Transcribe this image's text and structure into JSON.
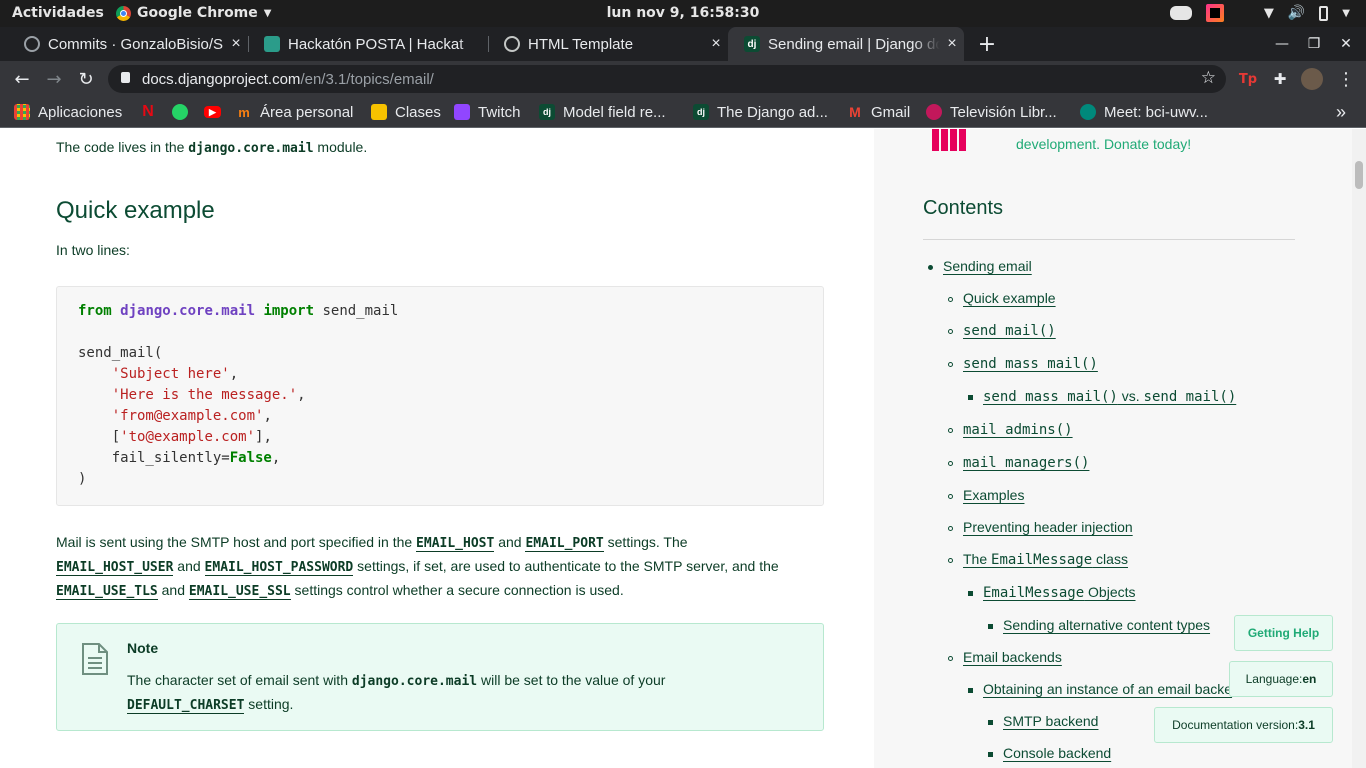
{
  "gnome": {
    "activities": "Actividades",
    "app_name": "Google Chrome",
    "clock": "lun nov  9, 16:58:30"
  },
  "tabs": [
    {
      "title": "Commits · GonzaloBisio/S",
      "close": "×"
    },
    {
      "title": "Hackatón POSTA | Hackat",
      "close": ""
    },
    {
      "title": "HTML Template",
      "close": "×"
    },
    {
      "title": "Sending email | Django do",
      "close": "×"
    }
  ],
  "new_tab": "+",
  "window_controls": {
    "minimize": "—",
    "maximize": "❐",
    "close": "✕"
  },
  "omnibox": {
    "domain": "docs.djangoproject.com",
    "path": "/en/3.1/topics/email/"
  },
  "bookmarks": [
    {
      "label": "Aplicaciones"
    },
    {
      "label": ""
    },
    {
      "label": ""
    },
    {
      "label": ""
    },
    {
      "label": "Área personal"
    },
    {
      "label": "Clases"
    },
    {
      "label": "Twitch"
    },
    {
      "label": "Model field re..."
    },
    {
      "label": "The Django ad..."
    },
    {
      "label": "Gmail"
    },
    {
      "label": "Televisión Libr..."
    },
    {
      "label": "Meet: bci-uwv..."
    }
  ],
  "bookmarks_more": "»",
  "content": {
    "intro_pre": "The code lives in the ",
    "intro_code": "django.core.mail",
    "intro_post": " module.",
    "heading": "Quick example",
    "two_lines": "In two lines:",
    "code": {
      "l1_kw1": "from",
      "l1_mod": "django.core.mail",
      "l1_kw2": "import",
      "l1_name": "send_mail",
      "l3": "send_mail(",
      "l4_indent": "    ",
      "l4_str": "'Subject here'",
      "l4_end": ",",
      "l5_indent": "    ",
      "l5_str": "'Here is the message.'",
      "l5_end": ",",
      "l6_indent": "    ",
      "l6_str": "'from@example.com'",
      "l6_end": ",",
      "l7_indent": "    [",
      "l7_str": "'to@example.com'",
      "l7_end": "],",
      "l8_indent": "    fail_silently=",
      "l8_kw": "False",
      "l8_end": ",",
      "l9": ")"
    },
    "para": {
      "a": "Mail is sent using the SMTP host and port specified in the ",
      "c1": "EMAIL_HOST",
      "b": " and ",
      "c2": "EMAIL_PORT",
      "c": " settings. The",
      "c3": "EMAIL_HOST_USER",
      "d": " and ",
      "c4": "EMAIL_HOST_PASSWORD",
      "e": " settings, if set, are used to authenticate to the SMTP server, and the",
      "c5": "EMAIL_USE_TLS",
      "f": " and ",
      "c6": "EMAIL_USE_SSL",
      "g": " settings control whether a secure connection is used."
    },
    "note": {
      "title": "Note",
      "a": "The character set of email sent with ",
      "code1": "django.core.mail",
      "b": " will be set to the value of your",
      "code2": "DEFAULT_CHARSET",
      "c": " setting."
    }
  },
  "sidebar": {
    "donate": "development. Donate today!",
    "contents_title": "Contents",
    "toc": [
      {
        "text": "Sending email",
        "level": 1
      },
      {
        "text": "Quick example",
        "level": 2
      },
      {
        "text": "send_mail()",
        "level": 2,
        "mono": true
      },
      {
        "text": "send_mass_mail()",
        "level": 2,
        "mono": true
      },
      {
        "text": "send_mass_mail()",
        "text2": " vs. ",
        "text3": "send_mail()",
        "level": 3
      },
      {
        "text": "mail_admins()",
        "level": 2,
        "mono": true
      },
      {
        "text": "mail_managers()",
        "level": 2,
        "mono": true
      },
      {
        "text": "Examples",
        "level": 2
      },
      {
        "text": "Preventing header injection",
        "level": 2
      },
      {
        "text": "The ",
        "text2": "EmailMessage",
        "text3": " class",
        "level": 2
      },
      {
        "text": "EmailMessage",
        "text2": " Objects",
        "level": 3
      },
      {
        "text": "Sending alternative content types",
        "level": 4
      },
      {
        "text": "Email backends",
        "level": 2
      },
      {
        "text": "Obtaining an instance of an email backe",
        "level": 3
      },
      {
        "text": "SMTP backend",
        "level": 4
      },
      {
        "text": "Console backend",
        "level": 4
      }
    ],
    "getting_help": "Getting Help",
    "language_label": "Language: ",
    "language_value": "en",
    "docver_label": "Documentation version: ",
    "docver_value": "3.1"
  }
}
